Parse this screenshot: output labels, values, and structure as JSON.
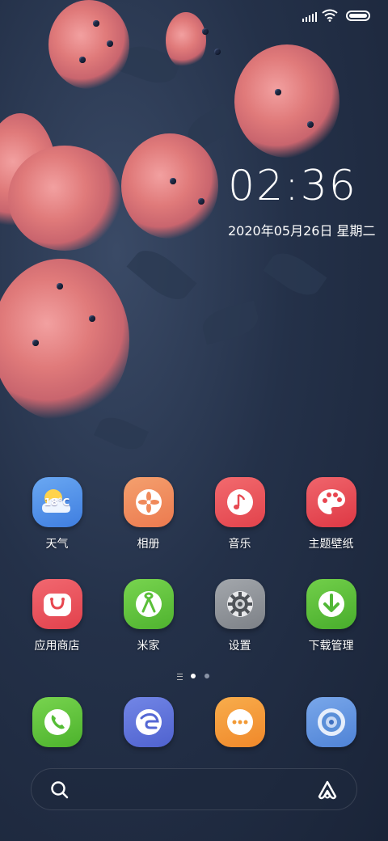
{
  "status_bar": {
    "signal_icon": "signal-bars-icon",
    "wifi_icon": "wifi-icon",
    "battery_icon": "battery-icon"
  },
  "clock": {
    "time": "02:36",
    "date": "2020年05月26日 星期二"
  },
  "apps": [
    {
      "id": "weather",
      "label": "天气",
      "icon": "weather-sun-cloud-icon",
      "badge_text": "18°C",
      "color": "#4a8ee6"
    },
    {
      "id": "gallery",
      "label": "相册",
      "icon": "gallery-flower-icon",
      "color": "#f08a5e"
    },
    {
      "id": "music",
      "label": "音乐",
      "icon": "music-note-icon",
      "color": "#e94f55"
    },
    {
      "id": "themes",
      "label": "主题壁纸",
      "icon": "palette-icon",
      "color": "#e9434d"
    },
    {
      "id": "app-store",
      "label": "应用商店",
      "icon": "shopping-bag-icon",
      "color": "#ea4a55"
    },
    {
      "id": "mijia",
      "label": "米家",
      "icon": "mijia-ribbon-icon",
      "color": "#5bc43a"
    },
    {
      "id": "settings",
      "label": "设置",
      "icon": "gear-icon",
      "color": "#8f9398"
    },
    {
      "id": "downloads",
      "label": "下载管理",
      "icon": "download-arrow-icon",
      "color": "#53b93a"
    }
  ],
  "page_indicator": {
    "current": 1,
    "total": 2,
    "active_color": "#ffffff",
    "inactive_color": "#8a93a6"
  },
  "dock": [
    {
      "id": "phone",
      "icon": "phone-icon",
      "color": "#58c53b"
    },
    {
      "id": "browser",
      "icon": "browser-icon",
      "color": "#5a6fd8"
    },
    {
      "id": "messages",
      "icon": "messages-icon",
      "color": "#f59a36"
    },
    {
      "id": "camera",
      "icon": "camera-lens-icon",
      "color": "#5a8fd8"
    }
  ],
  "search": {
    "search_icon": "search-icon",
    "assistant_icon": "assistant-icon"
  }
}
